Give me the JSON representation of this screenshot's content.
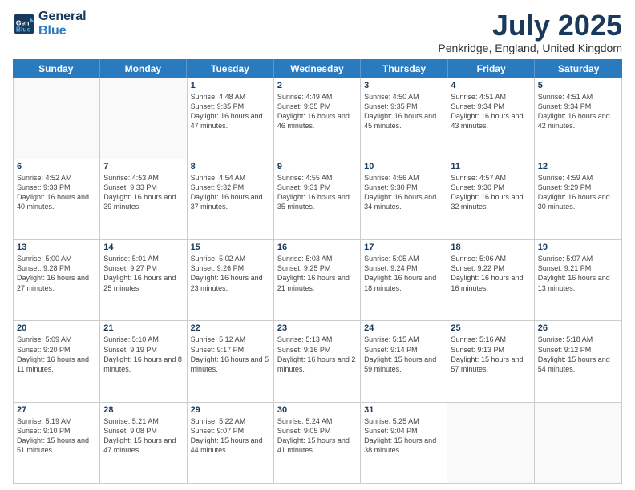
{
  "logo": {
    "line1": "General",
    "line2": "Blue"
  },
  "title": "July 2025",
  "subtitle": "Penkridge, England, United Kingdom",
  "days": [
    "Sunday",
    "Monday",
    "Tuesday",
    "Wednesday",
    "Thursday",
    "Friday",
    "Saturday"
  ],
  "weeks": [
    [
      {
        "day": "",
        "sunrise": "",
        "sunset": "",
        "daylight": ""
      },
      {
        "day": "",
        "sunrise": "",
        "sunset": "",
        "daylight": ""
      },
      {
        "day": "1",
        "sunrise": "Sunrise: 4:48 AM",
        "sunset": "Sunset: 9:35 PM",
        "daylight": "Daylight: 16 hours and 47 minutes."
      },
      {
        "day": "2",
        "sunrise": "Sunrise: 4:49 AM",
        "sunset": "Sunset: 9:35 PM",
        "daylight": "Daylight: 16 hours and 46 minutes."
      },
      {
        "day": "3",
        "sunrise": "Sunrise: 4:50 AM",
        "sunset": "Sunset: 9:35 PM",
        "daylight": "Daylight: 16 hours and 45 minutes."
      },
      {
        "day": "4",
        "sunrise": "Sunrise: 4:51 AM",
        "sunset": "Sunset: 9:34 PM",
        "daylight": "Daylight: 16 hours and 43 minutes."
      },
      {
        "day": "5",
        "sunrise": "Sunrise: 4:51 AM",
        "sunset": "Sunset: 9:34 PM",
        "daylight": "Daylight: 16 hours and 42 minutes."
      }
    ],
    [
      {
        "day": "6",
        "sunrise": "Sunrise: 4:52 AM",
        "sunset": "Sunset: 9:33 PM",
        "daylight": "Daylight: 16 hours and 40 minutes."
      },
      {
        "day": "7",
        "sunrise": "Sunrise: 4:53 AM",
        "sunset": "Sunset: 9:33 PM",
        "daylight": "Daylight: 16 hours and 39 minutes."
      },
      {
        "day": "8",
        "sunrise": "Sunrise: 4:54 AM",
        "sunset": "Sunset: 9:32 PM",
        "daylight": "Daylight: 16 hours and 37 minutes."
      },
      {
        "day": "9",
        "sunrise": "Sunrise: 4:55 AM",
        "sunset": "Sunset: 9:31 PM",
        "daylight": "Daylight: 16 hours and 35 minutes."
      },
      {
        "day": "10",
        "sunrise": "Sunrise: 4:56 AM",
        "sunset": "Sunset: 9:30 PM",
        "daylight": "Daylight: 16 hours and 34 minutes."
      },
      {
        "day": "11",
        "sunrise": "Sunrise: 4:57 AM",
        "sunset": "Sunset: 9:30 PM",
        "daylight": "Daylight: 16 hours and 32 minutes."
      },
      {
        "day": "12",
        "sunrise": "Sunrise: 4:59 AM",
        "sunset": "Sunset: 9:29 PM",
        "daylight": "Daylight: 16 hours and 30 minutes."
      }
    ],
    [
      {
        "day": "13",
        "sunrise": "Sunrise: 5:00 AM",
        "sunset": "Sunset: 9:28 PM",
        "daylight": "Daylight: 16 hours and 27 minutes."
      },
      {
        "day": "14",
        "sunrise": "Sunrise: 5:01 AM",
        "sunset": "Sunset: 9:27 PM",
        "daylight": "Daylight: 16 hours and 25 minutes."
      },
      {
        "day": "15",
        "sunrise": "Sunrise: 5:02 AM",
        "sunset": "Sunset: 9:26 PM",
        "daylight": "Daylight: 16 hours and 23 minutes."
      },
      {
        "day": "16",
        "sunrise": "Sunrise: 5:03 AM",
        "sunset": "Sunset: 9:25 PM",
        "daylight": "Daylight: 16 hours and 21 minutes."
      },
      {
        "day": "17",
        "sunrise": "Sunrise: 5:05 AM",
        "sunset": "Sunset: 9:24 PM",
        "daylight": "Daylight: 16 hours and 18 minutes."
      },
      {
        "day": "18",
        "sunrise": "Sunrise: 5:06 AM",
        "sunset": "Sunset: 9:22 PM",
        "daylight": "Daylight: 16 hours and 16 minutes."
      },
      {
        "day": "19",
        "sunrise": "Sunrise: 5:07 AM",
        "sunset": "Sunset: 9:21 PM",
        "daylight": "Daylight: 16 hours and 13 minutes."
      }
    ],
    [
      {
        "day": "20",
        "sunrise": "Sunrise: 5:09 AM",
        "sunset": "Sunset: 9:20 PM",
        "daylight": "Daylight: 16 hours and 11 minutes."
      },
      {
        "day": "21",
        "sunrise": "Sunrise: 5:10 AM",
        "sunset": "Sunset: 9:19 PM",
        "daylight": "Daylight: 16 hours and 8 minutes."
      },
      {
        "day": "22",
        "sunrise": "Sunrise: 5:12 AM",
        "sunset": "Sunset: 9:17 PM",
        "daylight": "Daylight: 16 hours and 5 minutes."
      },
      {
        "day": "23",
        "sunrise": "Sunrise: 5:13 AM",
        "sunset": "Sunset: 9:16 PM",
        "daylight": "Daylight: 16 hours and 2 minutes."
      },
      {
        "day": "24",
        "sunrise": "Sunrise: 5:15 AM",
        "sunset": "Sunset: 9:14 PM",
        "daylight": "Daylight: 15 hours and 59 minutes."
      },
      {
        "day": "25",
        "sunrise": "Sunrise: 5:16 AM",
        "sunset": "Sunset: 9:13 PM",
        "daylight": "Daylight: 15 hours and 57 minutes."
      },
      {
        "day": "26",
        "sunrise": "Sunrise: 5:18 AM",
        "sunset": "Sunset: 9:12 PM",
        "daylight": "Daylight: 15 hours and 54 minutes."
      }
    ],
    [
      {
        "day": "27",
        "sunrise": "Sunrise: 5:19 AM",
        "sunset": "Sunset: 9:10 PM",
        "daylight": "Daylight: 15 hours and 51 minutes."
      },
      {
        "day": "28",
        "sunrise": "Sunrise: 5:21 AM",
        "sunset": "Sunset: 9:08 PM",
        "daylight": "Daylight: 15 hours and 47 minutes."
      },
      {
        "day": "29",
        "sunrise": "Sunrise: 5:22 AM",
        "sunset": "Sunset: 9:07 PM",
        "daylight": "Daylight: 15 hours and 44 minutes."
      },
      {
        "day": "30",
        "sunrise": "Sunrise: 5:24 AM",
        "sunset": "Sunset: 9:05 PM",
        "daylight": "Daylight: 15 hours and 41 minutes."
      },
      {
        "day": "31",
        "sunrise": "Sunrise: 5:25 AM",
        "sunset": "Sunset: 9:04 PM",
        "daylight": "Daylight: 15 hours and 38 minutes."
      },
      {
        "day": "",
        "sunrise": "",
        "sunset": "",
        "daylight": ""
      },
      {
        "day": "",
        "sunrise": "",
        "sunset": "",
        "daylight": ""
      }
    ]
  ]
}
